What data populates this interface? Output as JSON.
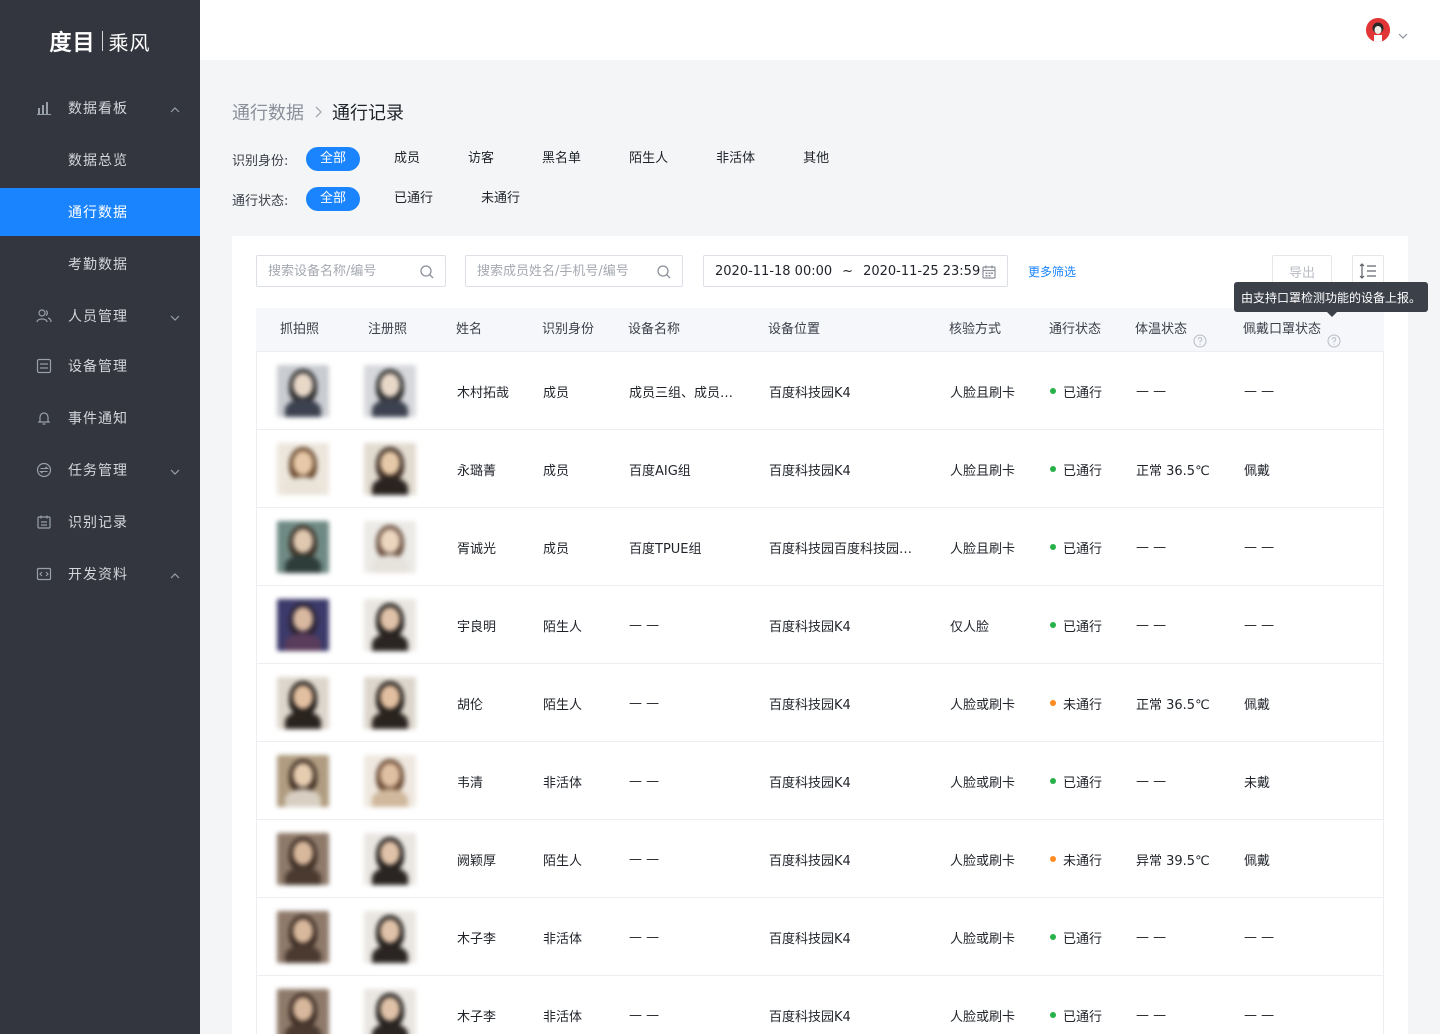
{
  "app": {
    "logo_main": "度目",
    "logo_sub": "乘风"
  },
  "sidebar": {
    "items": [
      {
        "label": "数据看板",
        "icon": "bar-chart-icon",
        "arrow": "up"
      },
      {
        "label": "数据总览"
      },
      {
        "label": "通行数据",
        "active": true
      },
      {
        "label": "考勤数据"
      },
      {
        "label": "人员管理",
        "icon": "users-icon",
        "arrow": "down"
      },
      {
        "label": "设备管理",
        "icon": "device-icon"
      },
      {
        "label": "事件通知",
        "icon": "bell-icon"
      },
      {
        "label": "任务管理",
        "icon": "task-icon",
        "arrow": "down"
      },
      {
        "label": "识别记录",
        "icon": "calendar-icon"
      },
      {
        "label": "开发资料",
        "icon": "code-icon",
        "arrow": "up"
      }
    ]
  },
  "breadcrumb": {
    "parent": "通行数据",
    "separator": ">",
    "current": "通行记录"
  },
  "filters": {
    "identity": {
      "label": "识别身份:",
      "options": [
        "全部",
        "成员",
        "访客",
        "黑名单",
        "陌生人",
        "非活体",
        "其他"
      ],
      "selected": "全部"
    },
    "status": {
      "label": "通行状态:",
      "options": [
        "全部",
        "已通行",
        "未通行"
      ],
      "selected": "全部"
    }
  },
  "toolbar": {
    "device_search_placeholder": "搜索设备名称/编号",
    "member_search_placeholder": "搜索成员姓名/手机号/编号",
    "date_start": "2020-11-18 00:00",
    "date_sep": "~",
    "date_end": "2020-11-25 23:59",
    "more_filter": "更多筛选",
    "export": "导出"
  },
  "tooltip": "由支持口罩检测功能的设备上报。",
  "table": {
    "columns": [
      "抓拍照",
      "注册照",
      "姓名",
      "识别身份",
      "设备名称",
      "设备位置",
      "核验方式",
      "通行状态",
      "体温状态",
      "佩戴口罩状态"
    ],
    "rows": [
      {
        "name": "木村拓哉",
        "identity": "成员",
        "device": "成员三组、成员…",
        "location": "百度科技园K4",
        "verify": "人脸且刷卡",
        "status": "已通行",
        "temp": "— —",
        "mask": "— —"
      },
      {
        "name": "永璐菁",
        "identity": "成员",
        "device": "百度AIG组",
        "location": "百度科技园K4",
        "verify": "人脸且刷卡",
        "status": "已通行",
        "temp": "正常 36.5℃",
        "mask": "佩戴"
      },
      {
        "name": "胥诚光",
        "identity": "成员",
        "device": "百度TPUE组",
        "location": "百度科技园百度科技园…",
        "verify": "人脸且刷卡",
        "status": "已通行",
        "temp": "— —",
        "mask": "— —"
      },
      {
        "name": "宇良明",
        "identity": "陌生人",
        "device": "— —",
        "location": "百度科技园K4",
        "verify": "仅人脸",
        "status": "已通行",
        "temp": "— —",
        "mask": "— —"
      },
      {
        "name": "胡伦",
        "identity": "陌生人",
        "device": "— —",
        "location": "百度科技园K4",
        "verify": "人脸或刷卡",
        "status": "未通行",
        "temp": "正常 36.5℃",
        "mask": "佩戴"
      },
      {
        "name": "韦清",
        "identity": "非活体",
        "device": "— —",
        "location": "百度科技园K4",
        "verify": "人脸或刷卡",
        "status": "已通行",
        "temp": "— —",
        "mask": "未戴"
      },
      {
        "name": "阙颖厚",
        "identity": "陌生人",
        "device": "— —",
        "location": "百度科技园K4",
        "verify": "人脸或刷卡",
        "status": "未通行",
        "temp": "异常 39.5℃",
        "mask": "佩戴"
      },
      {
        "name": "木子李",
        "identity": "非活体",
        "device": "— —",
        "location": "百度科技园K4",
        "verify": "人脸或刷卡",
        "status": "已通行",
        "temp": "— —",
        "mask": "— —"
      },
      {
        "name": "木子李",
        "identity": "非活体",
        "device": "— —",
        "location": "百度科技园K4",
        "verify": "人脸或刷卡",
        "status": "已通行",
        "temp": "— —",
        "mask": "— —"
      }
    ]
  },
  "colors": {
    "accent": "#1a84ff",
    "sidebar_bg": "#33363e",
    "passed": "#27b148",
    "not_passed": "#ff8a1f"
  }
}
